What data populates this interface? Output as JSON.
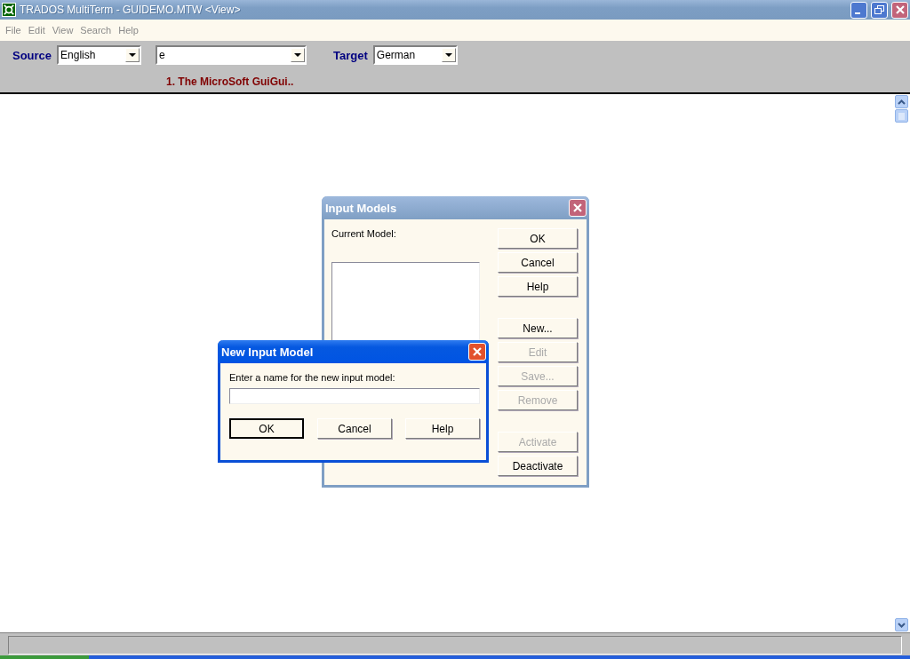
{
  "window": {
    "title": "TRADOS MultiTerm - GUIDEMO.MTW <View>"
  },
  "menu": [
    "File",
    "Edit",
    "View",
    "Search",
    "Help"
  ],
  "toolbar": {
    "source_label": "Source",
    "source_value": "English",
    "term_value": "e",
    "target_label": "Target",
    "target_value": "German",
    "entry_title": "1. The MicroSoft GuiGui.."
  },
  "input_models_dialog": {
    "title": "Input Models",
    "active": false,
    "current_model_label": "Current Model:",
    "button_groups": [
      [
        {
          "label": "OK",
          "disabled": false
        },
        {
          "label": "Cancel",
          "disabled": false
        },
        {
          "label": "Help",
          "disabled": false
        }
      ],
      [
        {
          "label": "New...",
          "disabled": false
        },
        {
          "label": "Edit",
          "disabled": true
        },
        {
          "label": "Save...",
          "disabled": true
        },
        {
          "label": "Remove",
          "disabled": true
        }
      ],
      [
        {
          "label": "Activate",
          "disabled": true
        },
        {
          "label": "Deactivate",
          "disabled": false
        }
      ]
    ]
  },
  "new_input_model_dialog": {
    "title": "New Input Model",
    "active": true,
    "prompt": "Enter a name for the new input model:",
    "buttons": [
      {
        "label": "OK",
        "default": true
      },
      {
        "label": "Cancel",
        "default": false
      },
      {
        "label": "Help",
        "default": false
      }
    ]
  }
}
